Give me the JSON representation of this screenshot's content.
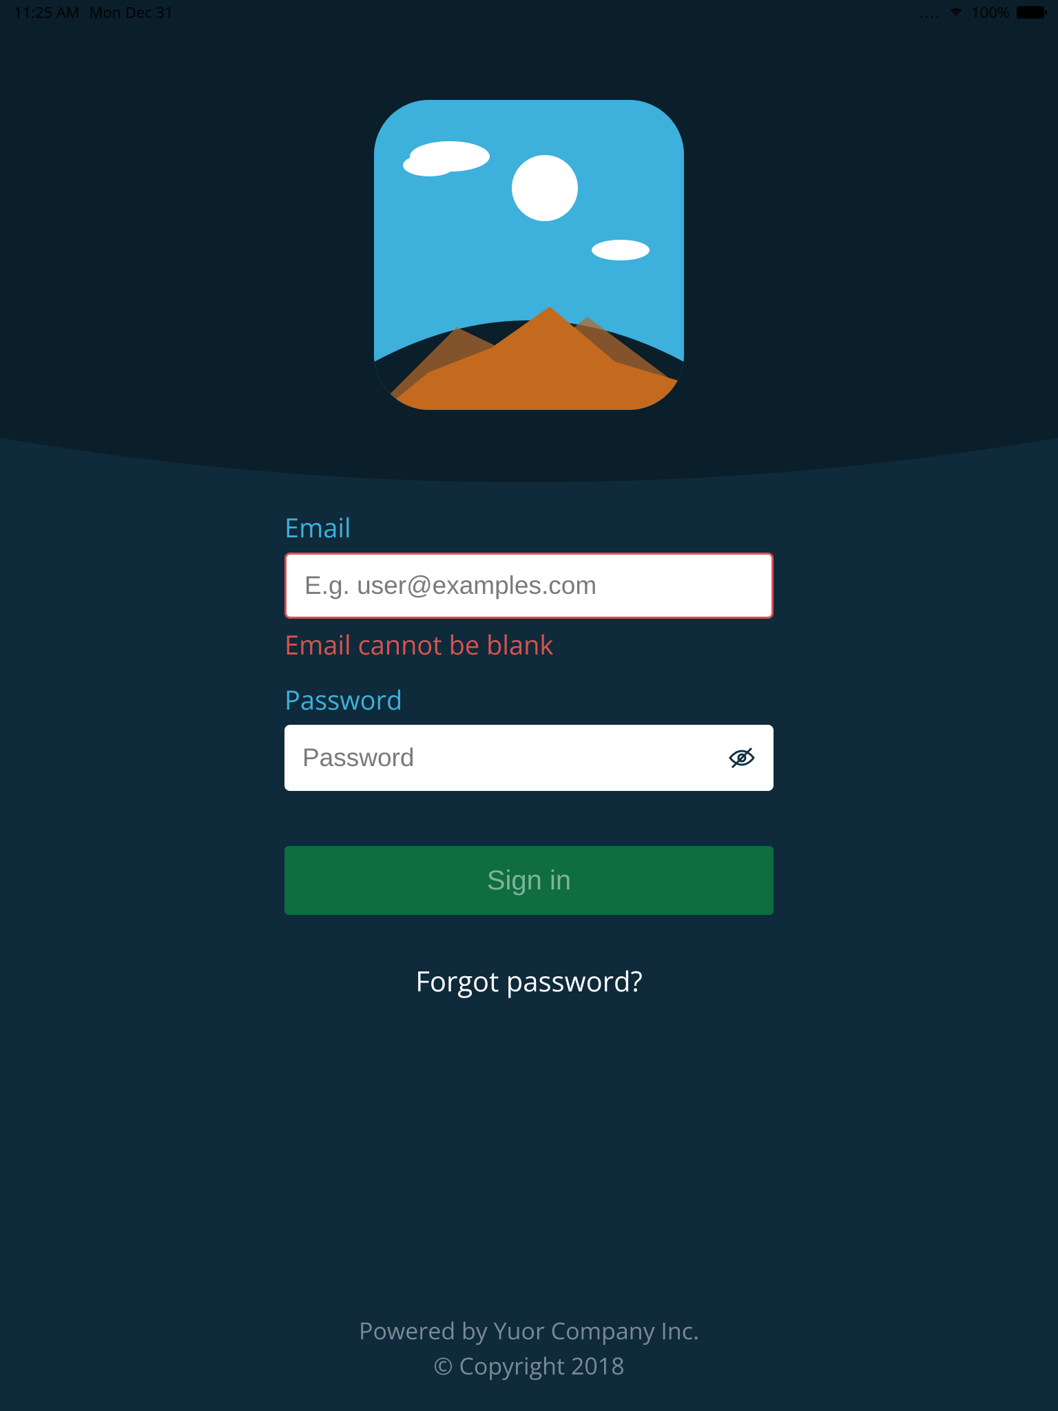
{
  "status_bar": {
    "time": "11:25 AM",
    "date": "Mon Dec 31",
    "battery_pct": "100%"
  },
  "form": {
    "email_label": "Email",
    "email_placeholder": "E.g. user@examples.com",
    "email_error": "Email cannot be blank",
    "password_label": "Password",
    "password_placeholder": "Password",
    "signin_label": "Sign in",
    "forgot_label": "Forgot password?"
  },
  "footer": {
    "line1": "Powered by Yuor Company Inc.",
    "line2": "© Copyright 2018"
  },
  "colors": {
    "accent": "#3db0dc",
    "error": "#d9534f",
    "button": "#0f6d3f",
    "bg_dark": "#0a1f2a",
    "bg": "#0f2a3a"
  }
}
